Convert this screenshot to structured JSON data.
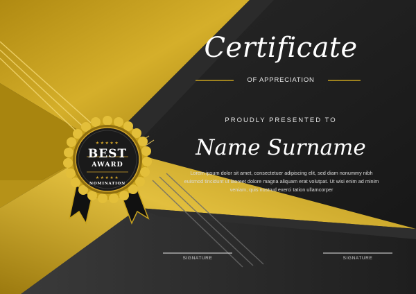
{
  "certificate": {
    "title": "Certificate",
    "subtitle": "OF APPRECIATION",
    "presented": "PROUDLY PRESENTED TO",
    "name": "Name Surname",
    "body": "Lorem ipsum dolor sit amet, consectetuer adipiscing elit, sed diam nonummy nibh euismod tincidunt ut laoreet dolore magna aliquam erat volutpat. Ut wisi enim ad minim veniam, quis nostrud exerci tation ullamcorper",
    "signature_left": "SIGNATURE",
    "signature_right": "SIGNATURE"
  },
  "badge": {
    "best": "BEST",
    "award": "AWARD",
    "nomination": "NOMINATION",
    "stars_top": "★★★★★",
    "stars_bottom": "★★★★★"
  },
  "colors": {
    "gold": "#c9a31e",
    "gold_light": "#e8c547",
    "gold_dark": "#8a6d0e",
    "background": "#1c1c1c",
    "text": "#ffffff"
  }
}
